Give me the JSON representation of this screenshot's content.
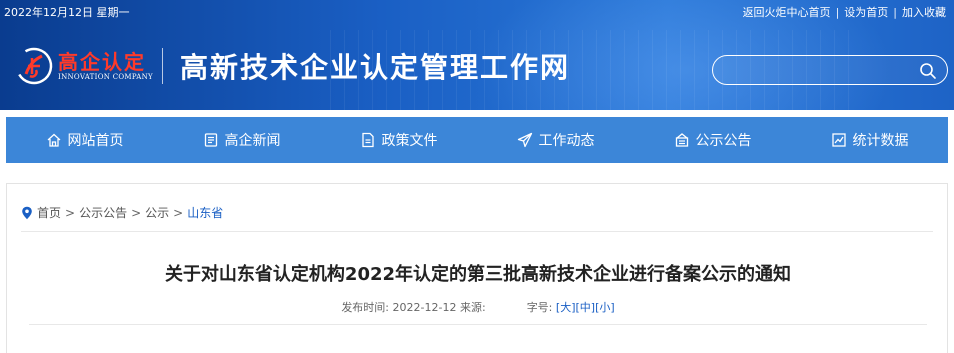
{
  "header": {
    "date": "2022年12月12日 星期一",
    "links": [
      "返回火炬中心首页",
      "设为首页",
      "加入收藏"
    ],
    "logo_cn": "高企认定",
    "logo_en": "INNOVATION COMPANY",
    "site_title": "高新技术企业认定管理工作网",
    "search_placeholder": "",
    "colors": {
      "brand_red": "#ff3a2a",
      "header_blue": "#1a5fc4"
    }
  },
  "nav": {
    "items": [
      {
        "label": "网站首页",
        "icon": "home-icon"
      },
      {
        "label": "高企新闻",
        "icon": "news-icon"
      },
      {
        "label": "政策文件",
        "icon": "document-icon"
      },
      {
        "label": "工作动态",
        "icon": "paper-plane-icon"
      },
      {
        "label": "公示公告",
        "icon": "notice-icon"
      },
      {
        "label": "统计数据",
        "icon": "chart-icon"
      }
    ],
    "color": "#3c86d8"
  },
  "breadcrumb": {
    "items": [
      "首页",
      "公示公告",
      "公示",
      "山东省"
    ],
    "separator": ">"
  },
  "article": {
    "title": "关于对山东省认定机构2022年认定的第三批高新技术企业进行备案公示的通知",
    "publish_label": "发布时间:",
    "publish_date": "2022-12-12",
    "source_label": "来源:",
    "font_size_label": "字号:",
    "font_sizes": [
      "[大]",
      "[中]",
      "[小]"
    ]
  }
}
